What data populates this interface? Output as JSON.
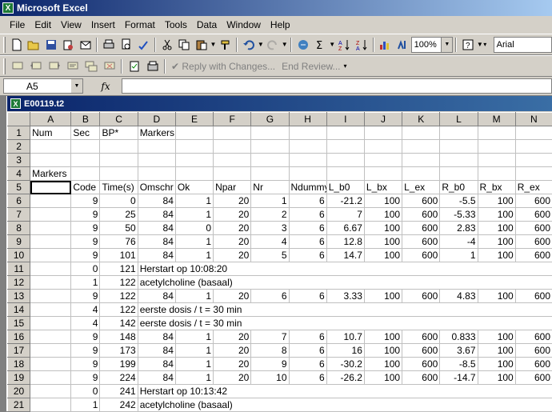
{
  "app": {
    "title": "Microsoft Excel"
  },
  "menu": [
    "File",
    "Edit",
    "View",
    "Insert",
    "Format",
    "Tools",
    "Data",
    "Window",
    "Help"
  ],
  "toolbar": {
    "zoom": "100%",
    "font": "Arial",
    "reply_label": "Reply with Changes...",
    "end_review_label": "End Review..."
  },
  "formula_bar": {
    "name_box": "A5",
    "fx": "fx",
    "value": ""
  },
  "workbook": {
    "title": "E00119.t2"
  },
  "sheet": {
    "columns": [
      "A",
      "B",
      "C",
      "D",
      "E",
      "F",
      "G",
      "H",
      "I",
      "J",
      "K",
      "L",
      "M",
      "N"
    ],
    "rows": [
      {
        "n": "1",
        "cells": [
          "Num",
          "Sec",
          "BP*",
          "Markers",
          "",
          "",
          "",
          "",
          "",
          "",
          "",
          "",
          "",
          ""
        ]
      },
      {
        "n": "2",
        "cells": [
          "",
          "",
          "",
          "",
          "",
          "",
          "",
          "",
          "",
          "",
          "",
          "",
          "",
          ""
        ]
      },
      {
        "n": "3",
        "cells": [
          "",
          "",
          "",
          "",
          "",
          "",
          "",
          "",
          "",
          "",
          "",
          "",
          "",
          ""
        ]
      },
      {
        "n": "4",
        "cells": [
          "Markers",
          "",
          "",
          "",
          "",
          "",
          "",
          "",
          "",
          "",
          "",
          "",
          "",
          ""
        ]
      },
      {
        "n": "5",
        "cells": [
          "",
          "Code",
          "Time(s)",
          "Omschr",
          "Ok",
          "Npar",
          "Nr",
          "Ndummy",
          "L_b0",
          "L_bx",
          "L_ex",
          "R_b0",
          "R_bx",
          "R_ex"
        ]
      },
      {
        "n": "6",
        "cells": [
          "",
          "9",
          "0",
          "84",
          "1",
          "20",
          "1",
          "6",
          "-21.2",
          "100",
          "600",
          "-5.5",
          "100",
          "600"
        ]
      },
      {
        "n": "7",
        "cells": [
          "",
          "9",
          "25",
          "84",
          "1",
          "20",
          "2",
          "6",
          "7",
          "100",
          "600",
          "-5.33",
          "100",
          "600"
        ]
      },
      {
        "n": "8",
        "cells": [
          "",
          "9",
          "50",
          "84",
          "0",
          "20",
          "3",
          "6",
          "6.67",
          "100",
          "600",
          "2.83",
          "100",
          "600"
        ]
      },
      {
        "n": "9",
        "cells": [
          "",
          "9",
          "76",
          "84",
          "1",
          "20",
          "4",
          "6",
          "12.8",
          "100",
          "600",
          "-4",
          "100",
          "600"
        ]
      },
      {
        "n": "10",
        "cells": [
          "",
          "9",
          "101",
          "84",
          "1",
          "20",
          "5",
          "6",
          "14.7",
          "100",
          "600",
          "1",
          "100",
          "600"
        ]
      },
      {
        "n": "11",
        "cells": [
          "",
          "0",
          "121",
          "Herstart op 10:08:20",
          "",
          "",
          "",
          "",
          "",
          "",
          "",
          "",
          "",
          ""
        ]
      },
      {
        "n": "12",
        "cells": [
          "",
          "1",
          "122",
          "acetylcholine (basaal)",
          "",
          "",
          "",
          "",
          "",
          "",
          "",
          "",
          "",
          ""
        ]
      },
      {
        "n": "13",
        "cells": [
          "",
          "9",
          "122",
          "84",
          "1",
          "20",
          "6",
          "6",
          "3.33",
          "100",
          "600",
          "4.83",
          "100",
          "600"
        ]
      },
      {
        "n": "14",
        "cells": [
          "",
          "4",
          "122",
          "eerste dosis / t = 30 min",
          "",
          "",
          "",
          "",
          "",
          "",
          "",
          "",
          "",
          ""
        ]
      },
      {
        "n": "15",
        "cells": [
          "",
          "4",
          "142",
          "eerste dosis / t = 30 min",
          "",
          "",
          "",
          "",
          "",
          "",
          "",
          "",
          "",
          ""
        ]
      },
      {
        "n": "16",
        "cells": [
          "",
          "9",
          "148",
          "84",
          "1",
          "20",
          "7",
          "6",
          "10.7",
          "100",
          "600",
          "0.833",
          "100",
          "600"
        ]
      },
      {
        "n": "17",
        "cells": [
          "",
          "9",
          "173",
          "84",
          "1",
          "20",
          "8",
          "6",
          "16",
          "100",
          "600",
          "3.67",
          "100",
          "600"
        ]
      },
      {
        "n": "18",
        "cells": [
          "",
          "9",
          "199",
          "84",
          "1",
          "20",
          "9",
          "6",
          "-30.2",
          "100",
          "600",
          "-8.5",
          "100",
          "600"
        ]
      },
      {
        "n": "19",
        "cells": [
          "",
          "9",
          "224",
          "84",
          "1",
          "20",
          "10",
          "6",
          "-26.2",
          "100",
          "600",
          "-14.7",
          "100",
          "600"
        ]
      },
      {
        "n": "20",
        "cells": [
          "",
          "0",
          "241",
          "Herstart op 10:13:42",
          "",
          "",
          "",
          "",
          "",
          "",
          "",
          "",
          "",
          ""
        ]
      },
      {
        "n": "21",
        "cells": [
          "",
          "1",
          "242",
          "acetylcholine (basaal)",
          "",
          "",
          "",
          "",
          "",
          "",
          "",
          "",
          "",
          ""
        ]
      }
    ],
    "active_cell": "A5"
  }
}
